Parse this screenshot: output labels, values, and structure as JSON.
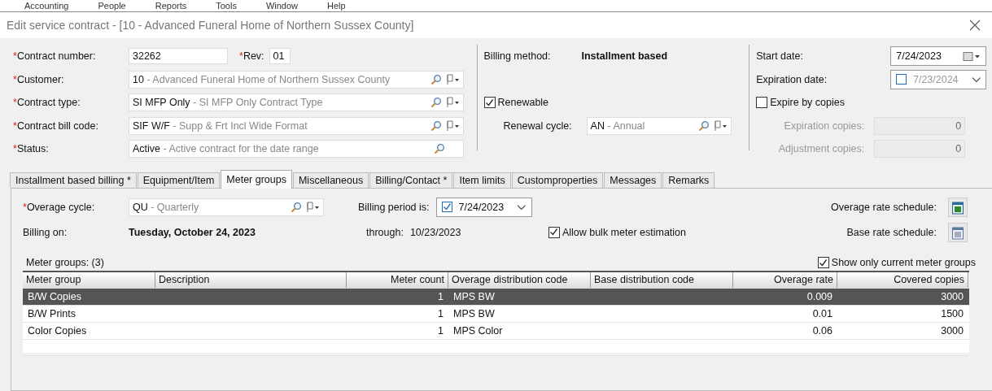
{
  "menu": [
    "Accounting",
    "People",
    "Reports",
    "Tools",
    "Window",
    "Help"
  ],
  "window": {
    "title": "Edit service contract - [10 - Advanced Funeral Home of Northern Sussex County]"
  },
  "header": {
    "fields": [
      {
        "kind": "pair",
        "mark": "*",
        "label": "Contract number:",
        "value": "32262",
        "rev": {
          "mark": "*",
          "label": "Rev:",
          "value": "01"
        }
      },
      {
        "kind": "combo",
        "mark": "*",
        "label": "Customer:",
        "code": "10",
        "description": "- Advanced Funeral Home of Northern Sussex County",
        "action": true
      },
      {
        "kind": "combo",
        "mark": "*",
        "label": "Contract type:",
        "code": "SI MFP Only",
        "description": "- SI MFP Only Contract Type",
        "action": true
      },
      {
        "kind": "combo",
        "mark": "*",
        "label": "Contract bill code:",
        "code": "SIF W/F",
        "description": "- Supp & Frt Incl Wide Format",
        "action": true
      },
      {
        "kind": "combo",
        "mark": "*",
        "label": "Status:",
        "code": "Active",
        "description": "- Active contract for the date range",
        "action": false
      }
    ]
  },
  "billing": {
    "method_label": "Billing method:",
    "method_value": "Installment based",
    "renewable": {
      "label": "Renewable",
      "checked": true
    },
    "renewal_cycle": {
      "label": "Renewal cycle:",
      "code": "AN",
      "description": "- Annual"
    }
  },
  "dates": {
    "start_date": {
      "label": "Start date:",
      "value": "7/24/2023"
    },
    "expiration_date": {
      "label": "Expiration date:",
      "value": "7/23/2024",
      "checked": false
    },
    "expire_by_copies": {
      "label": "Expire by copies",
      "checked": false
    },
    "copies": [
      {
        "label": "Expiration copies:",
        "value": "0",
        "disabled": true
      },
      {
        "label": "Adjustment copies:",
        "value": "0",
        "disabled": true
      }
    ]
  },
  "tabs": [
    {
      "label": "Installment based billing *",
      "selected": false
    },
    {
      "label": "Equipment/Item",
      "selected": false
    },
    {
      "label": "Meter groups",
      "selected": true
    },
    {
      "label": "Miscellaneous",
      "selected": false
    },
    {
      "label": "Billing/Contact *",
      "selected": false
    },
    {
      "label": "Item limits",
      "selected": false
    },
    {
      "label": "Customproperties",
      "selected": false
    },
    {
      "label": "Messages",
      "selected": false
    },
    {
      "label": "Remarks",
      "selected": false
    }
  ],
  "meter_groups": {
    "overage_cycle": {
      "mark": "*",
      "label": "Overage cycle:",
      "code": "QU",
      "description": "- Quarterly"
    },
    "billing_period": {
      "label": "Billing period is:",
      "checked": true,
      "value": "7/24/2023"
    },
    "overage_rate_schedule": {
      "label": "Overage rate schedule:"
    },
    "base_rate_schedule": {
      "label": "Base rate schedule:"
    },
    "billing_on": {
      "label": "Billing on:",
      "value": "Tuesday, October 24, 2023"
    },
    "through": {
      "label": "through:",
      "value": "10/23/2023"
    },
    "allow_bulk": {
      "label": "Allow bulk meter estimation",
      "checked": true
    },
    "table": {
      "label": "Meter groups: (3)",
      "show_current": {
        "label": "Show only current meter groups",
        "checked": true
      },
      "columns": [
        "Meter group",
        "Description",
        "Meter count",
        "Overage distribution code",
        "Base distribution code",
        "Overage rate",
        "Covered copies"
      ],
      "rows": [
        {
          "selected": true,
          "cells": [
            "B/W Copies",
            "",
            "1",
            "MPS BW",
            "",
            "0.009",
            "3000"
          ]
        },
        {
          "selected": false,
          "cells": [
            "B/W Prints",
            "",
            "1",
            "MPS BW",
            "",
            "0.01",
            "1500"
          ]
        },
        {
          "selected": false,
          "cells": [
            "Color Copies",
            "",
            "1",
            "MPS Color",
            "",
            "0.06",
            "3000"
          ]
        }
      ]
    }
  }
}
